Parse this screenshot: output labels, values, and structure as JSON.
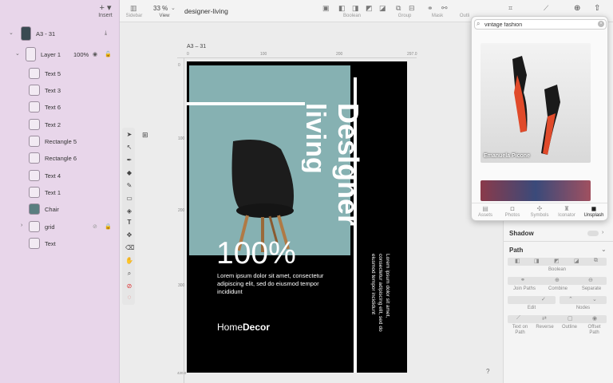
{
  "left_panel": {
    "insert_label": "Insert",
    "insert_icon": "plus-icon",
    "artboard_name": "A3 - 31",
    "layer_name": "Layer 1",
    "layer_opacity": "100%",
    "layers": [
      "Text 5",
      "Text 3",
      "Text 6",
      "Text 2",
      "Rectangle 5",
      "Rectangle 6",
      "Text 4",
      "Text 1",
      "Chair",
      "grid",
      "Text"
    ]
  },
  "toolbar": {
    "sidebar_label": "Sidebar",
    "zoom_value": "33 %",
    "view_label": "View",
    "doc_title": "designer-living",
    "boolean_label": "Boolean",
    "group_label": "Group",
    "mask_label": "Mask",
    "outline_label": "Outli"
  },
  "canvas": {
    "artboard_label": "A3 – 31",
    "ruler_ticks_top": [
      "0",
      "100",
      "200",
      "297.0"
    ],
    "ruler_ticks_left": [
      "0",
      "100",
      "200",
      "300",
      "420.0"
    ],
    "help_label": "?"
  },
  "artboard": {
    "title_line1": "Designer",
    "title_line2": "living",
    "percent": "100%",
    "body_text": "Lorem ipsum dolor sit amet, consectetur adipiscing elit, sed do eiusmod tempor incididunt",
    "vertical_text": "Lorem ipsum dolor sit amet, consectetur adipiscing elit, sed do eiusmod tempor incididunt",
    "brand_light": "Home",
    "brand_bold": "Decor",
    "photo_color": "#86b1b2"
  },
  "unsplash": {
    "search_value": "vintage fashion",
    "photo_credit": "Emanuela Picone",
    "tabs": [
      "Assets",
      "Photos",
      "Symbols",
      "Iconator",
      "Unsplash"
    ],
    "active_tab": "Unsplash"
  },
  "right_panel": {
    "shadow_label": "Shadow",
    "path_label": "Path",
    "boolean_label": "Boolean",
    "join_paths": "Join Paths",
    "combine": "Combine",
    "separate": "Separate",
    "edit": "Edit",
    "nodes": "Nodes",
    "text_on_path_1": "Text on",
    "text_on_path_2": "Path",
    "reverse": "Reverse",
    "outline": "Outline",
    "offset_path_1": "Offset",
    "offset_path_2": "Path"
  }
}
